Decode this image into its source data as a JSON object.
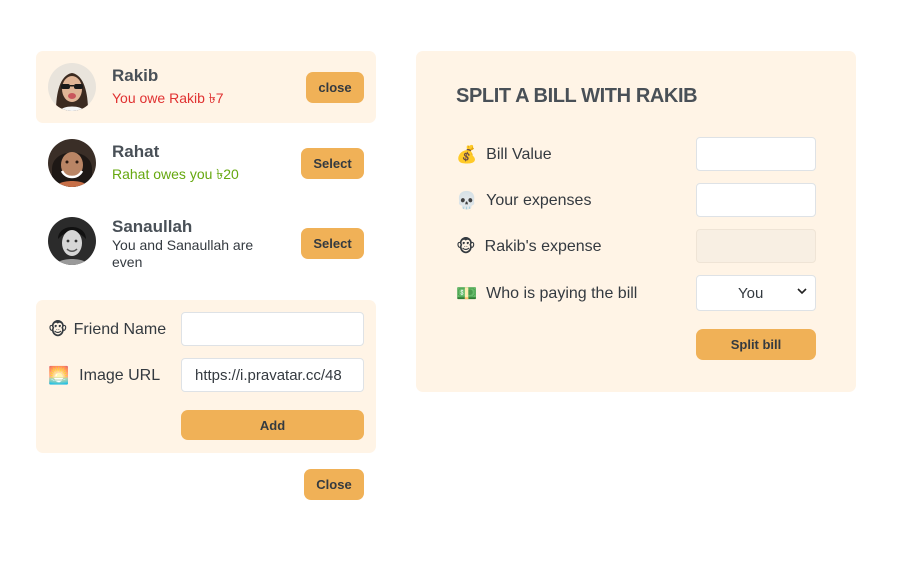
{
  "friends": [
    {
      "name": "Rakib",
      "status": "You owe Rakib ৳7",
      "status_type": "red",
      "button": "close",
      "selected": true
    },
    {
      "name": "Rahat",
      "status": "Rahat owes you ৳20",
      "status_type": "green",
      "button": "Select",
      "selected": false
    },
    {
      "name": "Sanaullah",
      "status": "You and Sanaullah are even",
      "status_type": "grey",
      "button": "Select",
      "selected": false
    }
  ],
  "add_form": {
    "friend_name_emoji": "🐵",
    "friend_name_label": "Friend Name",
    "friend_name_value": "",
    "image_url_emoji": "🌅",
    "image_url_label": "Image URL",
    "image_url_value": "https://i.pravatar.cc/48",
    "add_label": "Add"
  },
  "close_label": "Close",
  "split": {
    "title": "SPLIT A BILL WITH RAKIB",
    "bill_emoji": "💰",
    "bill_label": "Bill Value",
    "bill_value": "",
    "expense_emoji": "💀",
    "expense_label": "Your expenses",
    "expense_value": "",
    "friend_expense_emoji": "🐵",
    "friend_expense_label": "Rakib's expense",
    "friend_expense_value": "",
    "payer_emoji": "💵",
    "payer_label": "Who is paying the bill",
    "payer_selected": "You",
    "split_label": "Split bill"
  },
  "colors": {
    "accent": "#f0b157",
    "panel_bg": "#fff4e6",
    "owe_red": "#e03131",
    "owed_green": "#66a80f"
  }
}
